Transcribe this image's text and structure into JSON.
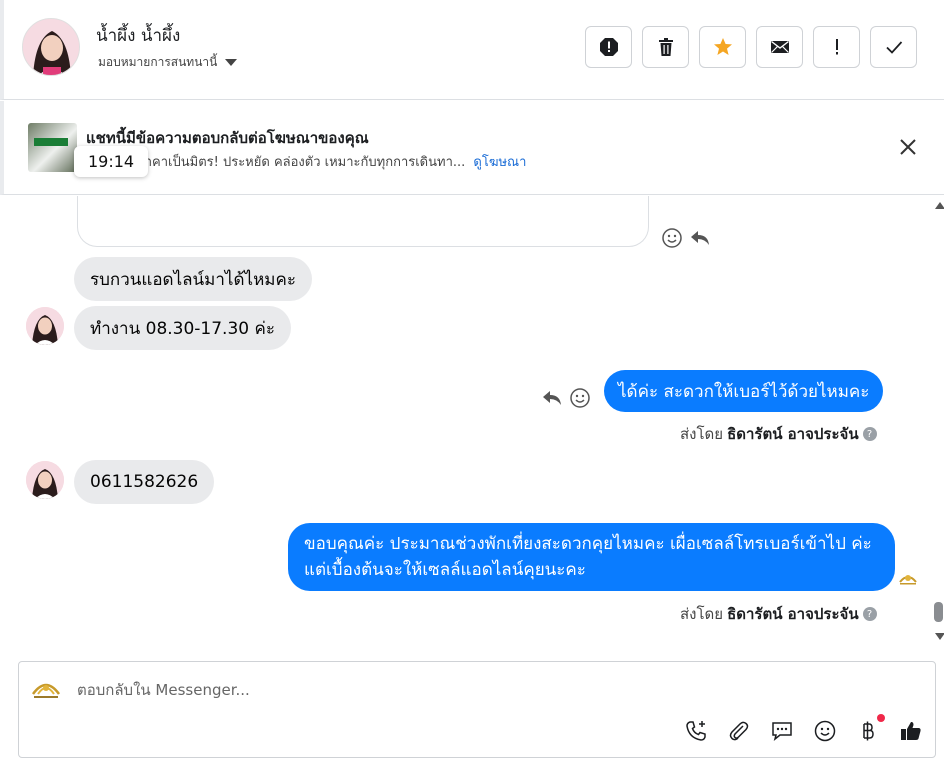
{
  "contact": {
    "name": "น้ำผึ้ง น้ำผึ้ง",
    "assign_label": "มอบหมายการสนทนานี้"
  },
  "toolbar": {
    "buttons": [
      "spam",
      "delete",
      "star",
      "mark-unread",
      "important",
      "done"
    ],
    "star_color": "#f5a623"
  },
  "banner": {
    "title": "แชทนี้มีข้อความตอบกลับต่อโฆษณาของคุณ",
    "description": "ว 7 ที่นั่ง ราคาเป็นมิตร! ประหยัด คล่องตัว เหมาะกับทุกการเดินทา...",
    "link": "ดูโฆษณา",
    "time_tooltip": "19:14"
  },
  "messages": {
    "in1": "รบกวนแอดไลน์มาได้ไหมคะ",
    "in2": "ทำงาน  08.30-17.30  ค่ะ",
    "out1": "ได้ค่ะ สะดวกให้เบอร์ไว้ด้วยไหมคะ",
    "in3": "0611582626",
    "out2": "ขอบคุณค่ะ ประมาณช่วงพักเที่ยงสะดวกคุยไหมคะ เผื่อเซลล์โทรเบอร์เข้าไป ค่ะ แต่เบื้องต้นจะให้เซลล์แอดไลน์คุยนะคะ",
    "sent_by_prefix": "ส่งโดย",
    "sent_by_name": "ธิดารัตน์ อาจประจัน"
  },
  "composer": {
    "placeholder": "ตอบกลับใน Messenger..."
  },
  "colors": {
    "outgoing": "#0a7cff",
    "incoming": "#e9eaec",
    "link": "#1a6cd6",
    "badge": "#f02849"
  }
}
